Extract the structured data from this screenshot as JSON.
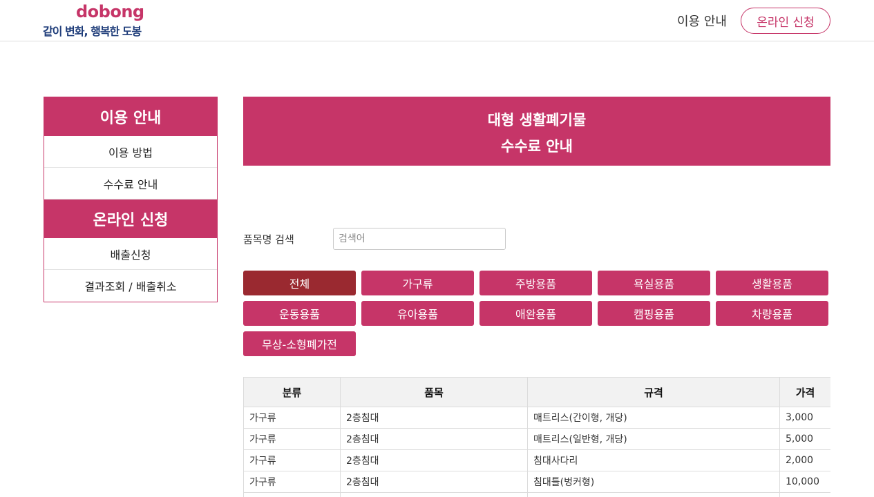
{
  "header": {
    "logo_top": "dobong",
    "logo_bottom": "같이 변화, 행복한 도봉",
    "nav_guide": "이용 안내",
    "nav_apply": "온라인 신청"
  },
  "sidebar": {
    "section1_title": "이용 안내",
    "section1_items": [
      "이용 방법",
      "수수료 안내"
    ],
    "section2_title": "온라인 신청",
    "section2_items": [
      "배출신청",
      "결과조회 / 배출취소"
    ]
  },
  "banner": {
    "line1": "대형 생활폐기물",
    "line2": "수수료 안내"
  },
  "search": {
    "label": "품목명 검색",
    "placeholder": "검색어",
    "value": ""
  },
  "categories": [
    "전체",
    "가구류",
    "주방용품",
    "욕실용품",
    "생활용품",
    "운동용품",
    "유아용품",
    "애완용품",
    "캠핑용품",
    "차량용품",
    "무상-소형폐가전"
  ],
  "active_category": "전체",
  "table": {
    "headers": [
      "분류",
      "품목",
      "규격",
      "가격"
    ],
    "rows": [
      [
        "가구류",
        "2층침대",
        "매트리스(간이형, 개당)",
        "3,000"
      ],
      [
        "가구류",
        "2층침대",
        "매트리스(일반형, 개당)",
        "5,000"
      ],
      [
        "가구류",
        "2층침대",
        "침대사다리",
        "2,000"
      ],
      [
        "가구류",
        "2층침대",
        "침대틀(벙커형)",
        "10,000"
      ],
      [
        "",
        "",
        "",
        ""
      ]
    ]
  },
  "colors": {
    "accent": "#c63568",
    "active": "#9a2930",
    "logo_blue": "#1f3d7a"
  }
}
